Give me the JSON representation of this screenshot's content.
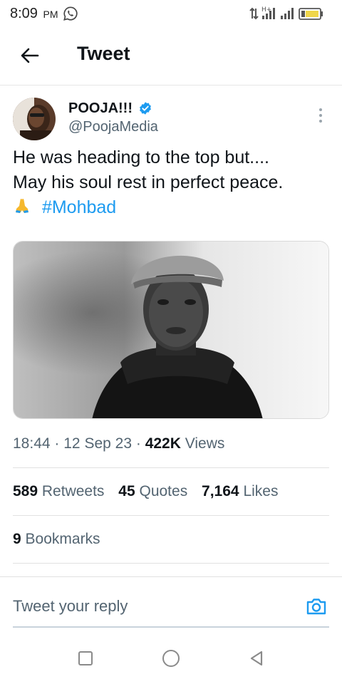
{
  "status_bar": {
    "time": "8:09",
    "ampm": "PM"
  },
  "header": {
    "title": "Tweet"
  },
  "tweet": {
    "author_name": "POOJA!!!",
    "author_handle": "@PoojaMedia",
    "text_line1": "He was heading to the top but....",
    "text_line2": "May his soul rest in perfect peace.",
    "hashtag": "#Mohbad",
    "emoji": "folded-hands",
    "time": "18:44",
    "date": "12 Sep 23",
    "views_count": "422K",
    "views_label": "Views",
    "separator": "·"
  },
  "stats": {
    "retweets_count": "589",
    "retweets_label": "Retweets",
    "quotes_count": "45",
    "quotes_label": "Quotes",
    "likes_count": "7,164",
    "likes_label": "Likes",
    "bookmarks_count": "9",
    "bookmarks_label": "Bookmarks"
  },
  "reply": {
    "placeholder": "Tweet your reply"
  },
  "colors": {
    "accent": "#1d9bf0",
    "text_primary": "#0f1419",
    "text_secondary": "#536471"
  }
}
